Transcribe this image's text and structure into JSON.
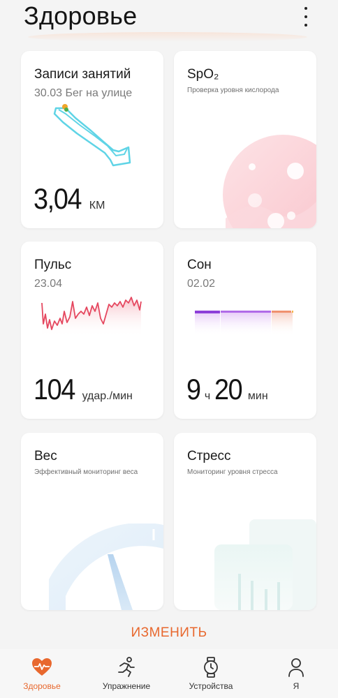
{
  "header": {
    "title": "Здоровье",
    "more_icon": "more-vert-icon"
  },
  "cards": {
    "activity": {
      "title": "Записи занятий",
      "subtitle": "30.03 Бег на улице",
      "value": "3,04",
      "unit": "КМ"
    },
    "spo2": {
      "title": "SpO₂",
      "subtitle": "Проверка уровня кислорода"
    },
    "pulse": {
      "title": "Пульс",
      "subtitle": "23.04",
      "value": "104",
      "unit": "удар./мин"
    },
    "sleep": {
      "title": "Сон",
      "subtitle": "02.02",
      "hours": "9",
      "hours_unit": "ч",
      "minutes": "20",
      "minutes_unit": "мин"
    },
    "weight": {
      "title": "Вес",
      "subtitle": "Эффективный мониторинг веса"
    },
    "stress": {
      "title": "Стресс",
      "subtitle": "Мониторинг уровня стресса"
    }
  },
  "edit_label": "ИЗМЕНИТЬ",
  "tabs": [
    {
      "label": "Здоровье",
      "icon": "heart-icon",
      "active": true
    },
    {
      "label": "Упражнение",
      "icon": "running-icon",
      "active": false
    },
    {
      "label": "Устройства",
      "icon": "watch-icon",
      "active": false
    },
    {
      "label": "Я",
      "icon": "person-icon",
      "active": false
    }
  ],
  "colors": {
    "accent": "#e8682e",
    "route": "#5fd4e6",
    "pulse_line": "#e5475f",
    "sleep_bar": "#a05ce6"
  }
}
